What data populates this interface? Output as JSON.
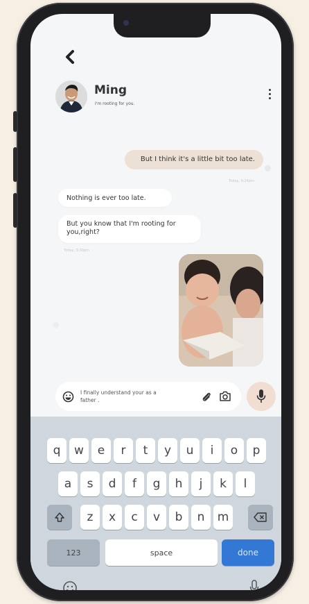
{
  "header": {
    "back_icon": "chevron-left-icon",
    "contact_name": "Ming",
    "contact_status": "I'm rooting for you.",
    "menu_icon": "more-vertical-icon"
  },
  "messages": [
    {
      "side": "out",
      "type": "text",
      "text": "But I think it's a little bit too late.",
      "time": "Today, 9:24pm"
    },
    {
      "side": "in",
      "type": "text",
      "text": "Nothing is ever too late."
    },
    {
      "side": "in",
      "type": "text",
      "text": "But you know that I'm rooting for you,right?",
      "time": "Today, 9:30pm"
    },
    {
      "side": "out",
      "type": "image",
      "description_icon": "photo-image"
    }
  ],
  "composer": {
    "emoji_icon": "emoji-icon",
    "value": "I finally understand your as a father .",
    "attach_icon": "paperclip-icon",
    "camera_icon": "camera-icon",
    "mic_icon": "microphone-icon"
  },
  "keyboard": {
    "row1": [
      "q",
      "w",
      "e",
      "r",
      "t",
      "y",
      "u",
      "i",
      "o",
      "p"
    ],
    "row2": [
      "a",
      "s",
      "d",
      "f",
      "g",
      "h",
      "j",
      "k",
      "l"
    ],
    "row3": [
      "z",
      "x",
      "c",
      "v",
      "b",
      "n",
      "m"
    ],
    "shift_icon": "shift-icon",
    "backspace_icon": "backspace-icon",
    "numbers_label": "123",
    "space_label": "space",
    "done_label": "done",
    "emoji_icon": "emoji-icon",
    "dictation_icon": "microphone-icon"
  },
  "colors": {
    "outgoing_bubble": "#ede0d5",
    "incoming_bubble": "#ffffff",
    "done_key": "#3478d5",
    "keyboard_bg": "#cfd6dd"
  }
}
